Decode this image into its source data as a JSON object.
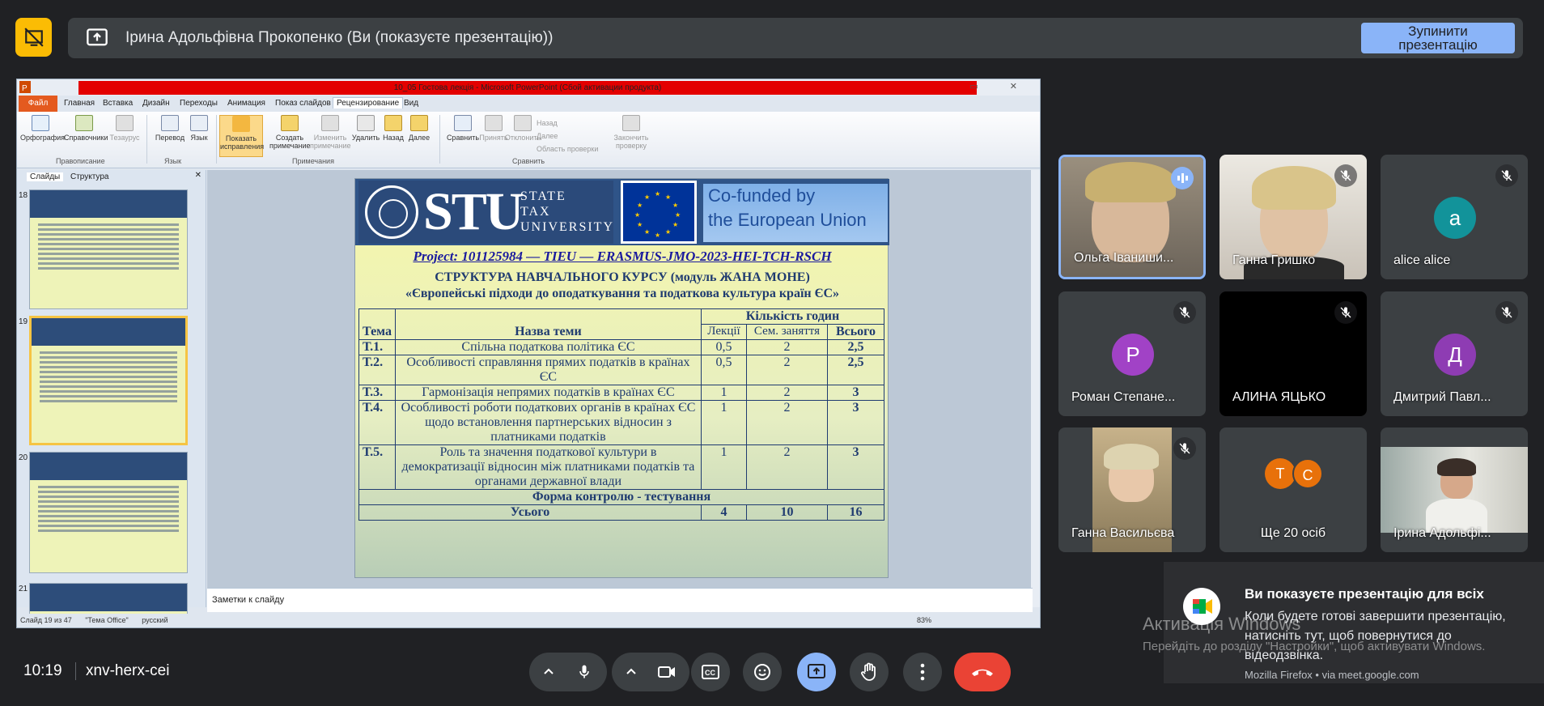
{
  "banner": {
    "text": "Ірина Адольфівна Прокопенко (Ви (показуєте презентацію))",
    "stop_label_1": "Зупинити",
    "stop_label_2": "презентацію"
  },
  "ppt": {
    "window_title": "10_05 Гостова лекція - Microsoft PowerPoint (Сбой активации продукта)",
    "tabs": [
      "Файл",
      "Главная",
      "Вставка",
      "Дизайн",
      "Переходы",
      "Анимация",
      "Показ слайдов",
      "Рецензирование",
      "Вид"
    ],
    "ribbon_buttons": [
      "Орфография",
      "Справочники",
      "Тезаурус",
      "Перевод",
      "Язык",
      "Показать исправления",
      "Создать примечание",
      "Изменить примечание",
      "Удалить",
      "Назад",
      "Далее",
      "Сравнить",
      "Принять",
      "Отклонить",
      "Назад",
      "Далее",
      "Область проверки",
      "Закончить проверку"
    ],
    "ribbon_groups": [
      "Правописание",
      "Язык",
      "Примечания",
      "Сравнить"
    ],
    "panel_tabs": [
      "Слайды",
      "Структура"
    ],
    "thumb_numbers": [
      "18",
      "19",
      "20",
      "21"
    ],
    "notes_placeholder": "Заметки к слайду",
    "status_slide": "Слайд 19 из 47",
    "status_theme": "\"Тема Office\"",
    "status_lang": "русский",
    "status_zoom": "83%"
  },
  "slide": {
    "stu_big": "STU",
    "stu_small_1": "STATE",
    "stu_small_2": "TAX",
    "stu_small_3": "UNIVERSITY",
    "cofund_1": "Co-funded by",
    "cofund_2": "the European Union",
    "project": "Project: 101125984 — TIEU — ERASMUS-JMO-2023-HEI-TCH-RSCH",
    "title_1": "СТРУКТУРА НАВЧАЛЬНОГО КУРСУ (модуль ЖАНА МОНЕ)",
    "title_2": "«Європейські підходи до оподаткування та податкова культура країн ЄС»",
    "headers": {
      "theme": "Тема",
      "name": "Назва теми",
      "hours": "Кількість годин",
      "lectures": "Лекції",
      "seminars": "Сем. заняття",
      "total": "Всього"
    },
    "rows": [
      {
        "t": "Т.1.",
        "name": "Спільна податкова політика ЄС",
        "lec": "0,5",
        "sem": "2",
        "tot": "2,5"
      },
      {
        "t": "Т.2.",
        "name": "Особливості справляння прямих податків в країнах ЄС",
        "lec": "0,5",
        "sem": "2",
        "tot": "2,5"
      },
      {
        "t": "Т.3.",
        "name": "Гармонізація непрямих податків в країнах ЄС",
        "lec": "1",
        "sem": "2",
        "tot": "3"
      },
      {
        "t": "Т.4.",
        "name": "Особливості роботи податкових органів в країнах ЄС щодо встановлення партнерських відносин з платниками податків",
        "lec": "1",
        "sem": "2",
        "tot": "3"
      },
      {
        "t": "Т.5.",
        "name": "Роль та значення податкової культури в демократизації відносин між платниками податків та органами державної влади",
        "lec": "1",
        "sem": "2",
        "tot": "3"
      }
    ],
    "control": "Форма контролю - тестування",
    "total_label": "Усього",
    "total_lec": "4",
    "total_sem": "10",
    "total_tot": "16"
  },
  "participants": [
    {
      "name": "Ольга Іваниши...",
      "status": "speaking"
    },
    {
      "name": "Ганна Гришко",
      "status": "muted"
    },
    {
      "name": "alice alice",
      "initial": "a",
      "color": "#12939a",
      "status": "muted"
    },
    {
      "name": "Роман Степане...",
      "initial": "Р",
      "color": "#a142c6",
      "status": "muted"
    },
    {
      "name": "АЛИНА ЯЦЬКО",
      "status": "muted"
    },
    {
      "name": "Дмитрий Павл...",
      "initial": "Д",
      "color": "#8e3cb3",
      "status": "muted"
    },
    {
      "name": "Ганна Васильєва",
      "status": "muted"
    },
    {
      "name": "Ще 20 осіб",
      "initials": [
        "Т",
        "С"
      ]
    },
    {
      "name": "Ірина Адольфі..."
    }
  ],
  "toast": {
    "title": "Ви показуєте презентацію для всіх",
    "body": "Коли будете готові завершити презентацію, натисніть тут, щоб повернутися до відеодзвінка.",
    "source": "Mozilla Firefox • via meet.google.com"
  },
  "watermark": {
    "line1": "Активація Windows",
    "line2": "Перейдіть до розділу \"Настройки\", щоб активувати Windows."
  },
  "bottom": {
    "time": "10:19",
    "meeting_code": "xnv-herx-cei"
  },
  "colors": {
    "meet_bg": "#202124",
    "stop_button": "#8ab4f8",
    "leave_button": "#ea4335",
    "present_active": "#8ab4f8",
    "presenting_icon": "#fbbc04"
  }
}
